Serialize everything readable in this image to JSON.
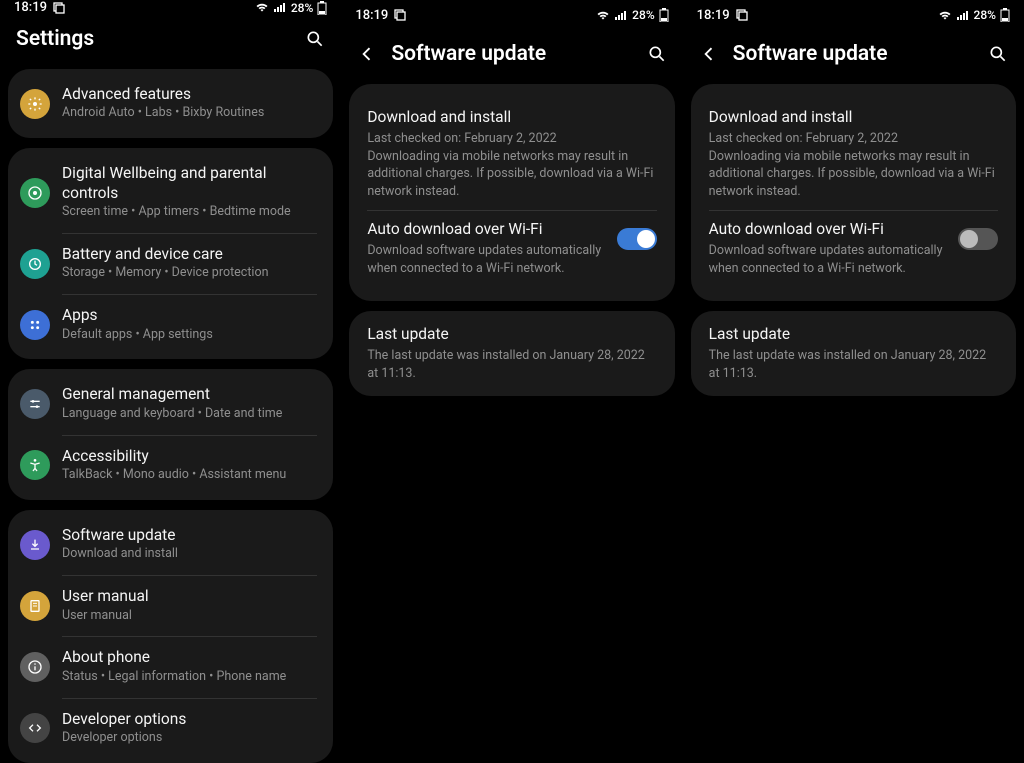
{
  "status": {
    "time": "18:19",
    "battery": "28%"
  },
  "settings": {
    "title": "Settings",
    "groups": [
      {
        "first": true,
        "items": [
          {
            "icon": "advanced-icon",
            "color": "#d4a43b",
            "title": "Advanced features",
            "sub": "Android Auto  •  Labs  •  Bixby Routines"
          }
        ]
      },
      {
        "items": [
          {
            "icon": "wellbeing-icon",
            "color": "#2e9b5b",
            "title": "Digital Wellbeing and parental controls",
            "sub": "Screen time  •  App timers  •  Bedtime mode"
          },
          {
            "icon": "battery-icon",
            "color": "#1ea192",
            "title": "Battery and device care",
            "sub": "Storage  •  Memory  •  Device protection"
          },
          {
            "icon": "apps-icon",
            "color": "#3d6fd6",
            "title": "Apps",
            "sub": "Default apps  •  App settings"
          }
        ]
      },
      {
        "items": [
          {
            "icon": "general-icon",
            "color": "#4a5a6a",
            "title": "General management",
            "sub": "Language and keyboard  •  Date and time"
          },
          {
            "icon": "accessibility-icon",
            "color": "#2e9b5b",
            "title": "Accessibility",
            "sub": "TalkBack  •  Mono audio  •  Assistant menu"
          }
        ]
      },
      {
        "items": [
          {
            "icon": "update-icon",
            "color": "#6a5acd",
            "title": "Software update",
            "sub": "Download and install"
          },
          {
            "icon": "manual-icon",
            "color": "#d4a43b",
            "title": "User manual",
            "sub": "User manual"
          },
          {
            "icon": "about-icon",
            "color": "#606060",
            "title": "About phone",
            "sub": "Status  •  Legal information  •  Phone name"
          },
          {
            "icon": "dev-icon",
            "color": "#444",
            "title": "Developer options",
            "sub": "Developer options"
          }
        ]
      }
    ]
  },
  "software_update": {
    "title": "Software update",
    "download": {
      "title": "Download and install",
      "checked": "Last checked on: February 2, 2022",
      "desc": "Downloading via mobile networks may result in additional charges. If possible, download via a Wi-Fi network instead."
    },
    "auto": {
      "title": "Auto download over Wi-Fi",
      "desc": "Download software updates automatically when connected to a Wi-Fi network."
    },
    "last": {
      "title": "Last update",
      "desc": "The last update was installed on January 28, 2022 at 11:13."
    }
  },
  "panels": [
    {
      "auto_on": true
    },
    {
      "auto_on": false
    }
  ]
}
